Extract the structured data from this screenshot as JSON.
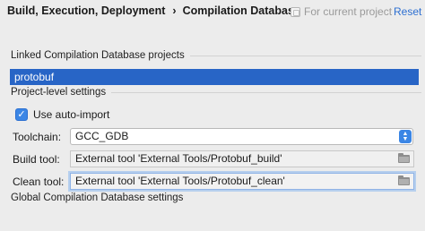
{
  "header": {
    "breadcrumb_parent": "Build, Execution, Deployment",
    "breadcrumb_separator": "›",
    "breadcrumb_current": "Compilation Database",
    "scope_label": "For current project",
    "reset_label": "Reset"
  },
  "linked_section": {
    "title": "Linked Compilation Database projects",
    "items": [
      {
        "label": "protobuf",
        "selected": true
      }
    ]
  },
  "project_settings": {
    "title": "Project-level settings",
    "auto_import": {
      "label": "Use auto-import",
      "checked": true,
      "check_glyph": "✓"
    },
    "toolchain": {
      "label": "Toolchain:",
      "value": "GCC_GDB",
      "arrow_up": "▲",
      "arrow_down": "▼"
    },
    "build_tool": {
      "label": "Build tool:",
      "value": "External tool 'External Tools/Protobuf_build'"
    },
    "clean_tool": {
      "label": "Clean tool:",
      "value": "External tool 'External Tools/Protobuf_clean'"
    }
  },
  "global_section": {
    "title": "Global Compilation Database settings"
  },
  "colors": {
    "accent": "#3b86e5",
    "selection": "#2865c6",
    "link": "#2d6fd1"
  }
}
